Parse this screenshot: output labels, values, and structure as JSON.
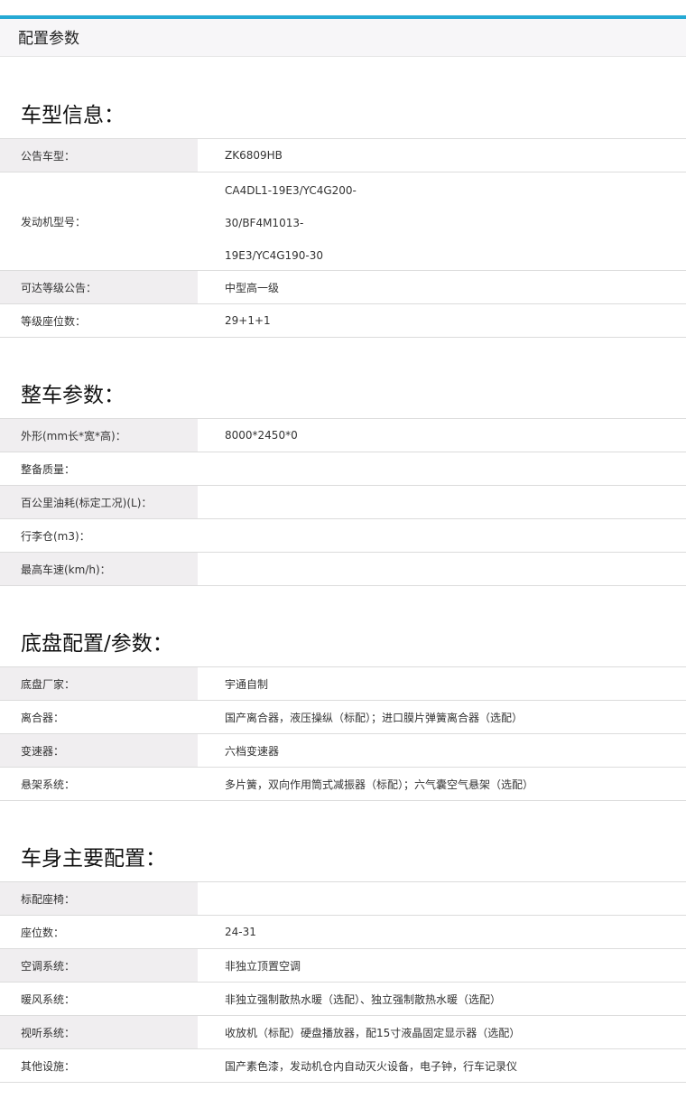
{
  "header": {
    "title": "配置参数"
  },
  "sections": [
    {
      "title": "车型信息：",
      "rows": [
        {
          "label": "公告车型：",
          "value": "ZK6809HB"
        },
        {
          "label": "发动机型号：",
          "value_lines": [
            "CA4DL1-19E3/YC4G200-",
            "30/BF4M1013-",
            "19E3/YC4G190-30"
          ]
        },
        {
          "label": "可达等级公告：",
          "value": "中型高一级"
        },
        {
          "label": "等级座位数：",
          "value": "29+1+1"
        }
      ]
    },
    {
      "title": "整车参数：",
      "rows": [
        {
          "label": "外形(mm长*宽*高)：",
          "value": "8000*2450*0"
        },
        {
          "label": "整备质量：",
          "value": ""
        },
        {
          "label": "百公里油耗(标定工况)(L)：",
          "value": ""
        },
        {
          "label": "行李仓(m3)：",
          "value": ""
        },
        {
          "label": "最高车速(km/h)：",
          "value": ""
        }
      ]
    },
    {
      "title": "底盘配置/参数：",
      "rows": [
        {
          "label": "底盘厂家：",
          "value": "宇通自制"
        },
        {
          "label": "离合器：",
          "value": "国产离合器，液压操纵（标配）；进口膜片弹簧离合器（选配）"
        },
        {
          "label": "变速器：",
          "value": "六档变速器"
        },
        {
          "label": "悬架系统：",
          "value": "多片簧，双向作用筒式减振器（标配）；六气囊空气悬架（选配）"
        }
      ]
    },
    {
      "title": "车身主要配置：",
      "rows": [
        {
          "label": "标配座椅：",
          "value": ""
        },
        {
          "label": "座位数：",
          "value": "24-31"
        },
        {
          "label": "空调系统：",
          "value": "非独立顶置空调"
        },
        {
          "label": "暖风系统：",
          "value": "非独立强制散热水暖（选配）、独立强制散热水暖（选配）"
        },
        {
          "label": "视听系统：",
          "value": "收放机（标配）硬盘播放器，配15寸液晶固定显示器（选配）"
        },
        {
          "label": "其他设施：",
          "value": "国产素色漆，发动机仓内自动灭火设备，电子钟，行车记录仪"
        }
      ]
    }
  ],
  "colors": {
    "accent": "#25a9d4",
    "label_shade": "#f0eef0",
    "header_bg": "#f7f6f8"
  }
}
